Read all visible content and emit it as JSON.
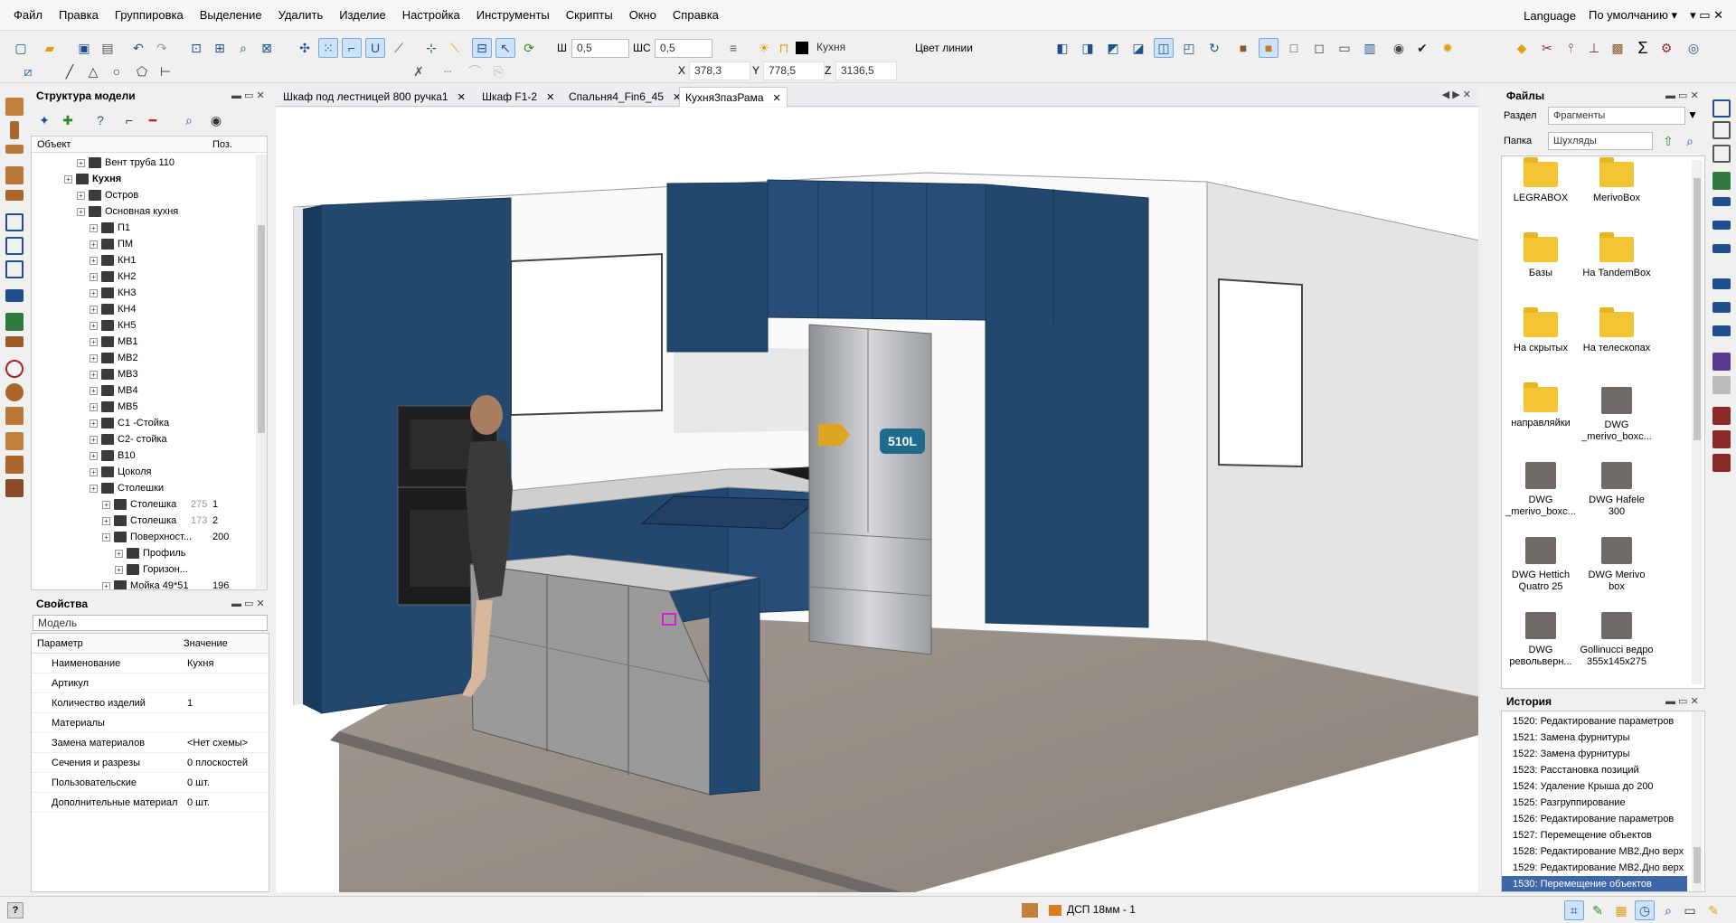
{
  "menu": [
    "Файл",
    "Правка",
    "Группировка",
    "Выделение",
    "Удалить",
    "Изделие",
    "Настройка",
    "Инструменты",
    "Скрипты",
    "Окно",
    "Справка"
  ],
  "menu_right": {
    "language": "Language",
    "default": "По умолчанию ▾",
    "controls": "▾ ▭ ✕"
  },
  "toolbar": {
    "w_label": "Ш",
    "w_value": "0,5",
    "shc_label": "ШС",
    "shc_value": "0,5",
    "layer_value": "Кухня",
    "line_color_label": "Цвет линии",
    "coords": {
      "x_label": "X",
      "x_value": "378,3",
      "y_label": "Y",
      "y_value": "778,5",
      "z_label": "Z",
      "z_value": "3136,5"
    }
  },
  "model_structure": {
    "title": "Структура модели",
    "col_object": "Объект",
    "col_pos": "Поз.",
    "rows": [
      {
        "label": "Вент труба 110",
        "indent": 3,
        "count": "",
        "pos": "",
        "bold": false
      },
      {
        "label": "Кухня",
        "indent": 2,
        "count": "",
        "pos": "",
        "bold": true
      },
      {
        "label": "Остров",
        "indent": 3,
        "count": "",
        "pos": "",
        "bold": false
      },
      {
        "label": "Основная кухня",
        "indent": 3,
        "count": "",
        "pos": "",
        "bold": false
      },
      {
        "label": "П1",
        "indent": 4,
        "count": "",
        "pos": "",
        "bold": false
      },
      {
        "label": "ПМ",
        "indent": 4,
        "count": "",
        "pos": "",
        "bold": false
      },
      {
        "label": "КН1",
        "indent": 4,
        "count": "",
        "pos": "",
        "bold": false
      },
      {
        "label": "КН2",
        "indent": 4,
        "count": "",
        "pos": "",
        "bold": false
      },
      {
        "label": "КН3",
        "indent": 4,
        "count": "",
        "pos": "",
        "bold": false
      },
      {
        "label": "КН4",
        "indent": 4,
        "count": "",
        "pos": "",
        "bold": false
      },
      {
        "label": "КН5",
        "indent": 4,
        "count": "",
        "pos": "",
        "bold": false
      },
      {
        "label": "МВ1",
        "indent": 4,
        "count": "",
        "pos": "",
        "bold": false
      },
      {
        "label": "МВ2",
        "indent": 4,
        "count": "",
        "pos": "",
        "bold": false
      },
      {
        "label": "МВ3",
        "indent": 4,
        "count": "",
        "pos": "",
        "bold": false
      },
      {
        "label": "МВ4",
        "indent": 4,
        "count": "",
        "pos": "",
        "bold": false
      },
      {
        "label": "МВ5",
        "indent": 4,
        "count": "",
        "pos": "",
        "bold": false
      },
      {
        "label": "С1 -Стойка",
        "indent": 4,
        "count": "",
        "pos": "",
        "bold": false
      },
      {
        "label": "С2- стойка",
        "indent": 4,
        "count": "",
        "pos": "",
        "bold": false
      },
      {
        "label": "В10",
        "indent": 4,
        "count": "",
        "pos": "",
        "bold": false
      },
      {
        "label": "Цоколя",
        "indent": 4,
        "count": "",
        "pos": "",
        "bold": false
      },
      {
        "label": "Столешки",
        "indent": 4,
        "count": "",
        "pos": "",
        "bold": false
      },
      {
        "label": "Столешка",
        "indent": 5,
        "count": "275",
        "pos": "1",
        "bold": false
      },
      {
        "label": "Столешка",
        "indent": 5,
        "count": "173",
        "pos": "2",
        "bold": false
      },
      {
        "label": "Поверхност...",
        "indent": 5,
        "count": "",
        "pos": "200",
        "bold": false
      },
      {
        "label": "Профиль",
        "indent": 6,
        "count": "",
        "pos": "",
        "bold": false
      },
      {
        "label": "Горизон...",
        "indent": 6,
        "count": "",
        "pos": "",
        "bold": false
      },
      {
        "label": "Мойка 49*51",
        "indent": 5,
        "count": "",
        "pos": "196",
        "bold": false
      }
    ]
  },
  "properties": {
    "title": "Свойства",
    "selector": "Модель",
    "col_param": "Параметр",
    "col_value": "Значение",
    "rows": [
      {
        "name": "Наименование",
        "value": "Кухня"
      },
      {
        "name": "Артикул",
        "value": ""
      },
      {
        "name": "Количество изделий",
        "value": "1"
      },
      {
        "name": "Материалы",
        "value": ""
      },
      {
        "name": "Замена материалов",
        "value": "<Нет схемы>"
      },
      {
        "name": "Сечения и разрезы",
        "value": "0 плоскостей"
      },
      {
        "name": "Пользовательские",
        "value": "0 шт."
      },
      {
        "name": "Дополнительные материал",
        "value": "0 шт."
      }
    ]
  },
  "tabs": [
    {
      "label": "Шкаф под лестницей 800 ручка1",
      "active": false
    },
    {
      "label": "Шкаф F1-2",
      "active": false
    },
    {
      "label": "Спальня4_Fin6_45",
      "active": false
    },
    {
      "label": "Кухня3пазРама",
      "active": true
    }
  ],
  "viewport": {
    "fridge_label": "510L"
  },
  "files": {
    "title": "Файлы",
    "section_label": "Раздел",
    "section_value": "Фрагменты",
    "folder_label": "Папка",
    "folder_value": "Шухляды",
    "items": [
      {
        "label": "LEGRABOX",
        "type": "folder"
      },
      {
        "label": "MerivoBox",
        "type": "folder"
      },
      {
        "label": "Базы",
        "type": "folder"
      },
      {
        "label": "На TandemBox",
        "type": "folder"
      },
      {
        "label": "На скрытых",
        "type": "folder"
      },
      {
        "label": "На телескопах",
        "type": "folder"
      },
      {
        "label": "направляйки",
        "type": "folder"
      },
      {
        "label": "DWG _merivo_boxc...",
        "type": "thumb"
      },
      {
        "label": "DWG _merivo_boxc...",
        "type": "thumb"
      },
      {
        "label": "DWG Hafele 300",
        "type": "thumb"
      },
      {
        "label": "DWG Hettich Quatro 25",
        "type": "thumb"
      },
      {
        "label": "DWG Merivo box",
        "type": "thumb"
      },
      {
        "label": "DWG револьверн...",
        "type": "thumb"
      },
      {
        "label": "Gollinucci ведро 355x145x275",
        "type": "thumb"
      }
    ]
  },
  "history": {
    "title": "История",
    "rows": [
      {
        "label": "1520:  Редактирование параметров",
        "selected": false
      },
      {
        "label": "1521:  Замена фурнитуры",
        "selected": false
      },
      {
        "label": "1522:  Замена фурнитуры",
        "selected": false
      },
      {
        "label": "1523:  Расстановка позиций",
        "selected": false
      },
      {
        "label": "1524:  Удаление Крыша до 200",
        "selected": false
      },
      {
        "label": "1525:  Разгруппирование",
        "selected": false
      },
      {
        "label": "1526:  Редактирование параметров",
        "selected": false
      },
      {
        "label": "1527:  Перемещение объектов",
        "selected": false
      },
      {
        "label": "1528:  Редактирование МВ2.Дно верх",
        "selected": false
      },
      {
        "label": "1529:  Редактирование МВ2.Дно верх",
        "selected": false
      },
      {
        "label": "1530:  Перемещение объектов",
        "selected": true
      }
    ]
  },
  "status": {
    "material": "ДСП 18мм - 1"
  },
  "colors": {
    "cabinet": "#224870",
    "accent": "#3e67a8",
    "tree_selected": "#3e67a8"
  }
}
